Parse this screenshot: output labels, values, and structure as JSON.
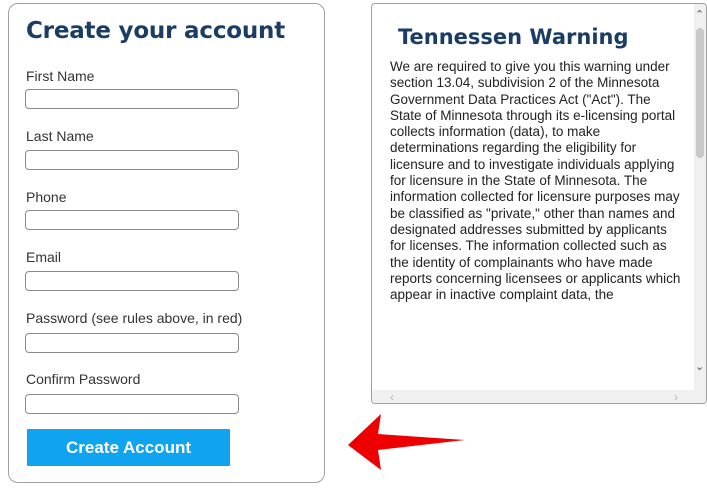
{
  "form": {
    "title": "Create your account",
    "fields": [
      {
        "label": "First Name",
        "value": ""
      },
      {
        "label": "Last Name",
        "value": ""
      },
      {
        "label": "Phone",
        "value": ""
      },
      {
        "label": "Email",
        "value": ""
      },
      {
        "label": "Password (see rules above, in red)",
        "value": ""
      },
      {
        "label": "Confirm Password",
        "value": ""
      }
    ],
    "submit_label": "Create Account",
    "submit_color": "#10a4f0",
    "title_color": "#1b3d64"
  },
  "warning": {
    "title": "Tennessen Warning",
    "body": "We are required to give you this warning under section 13.04, subdivision 2 of the Minnesota Government Data Practices Act (\"Act\"). The State of Minnesota through its e-licensing portal collects information (data), to make determinations regarding the eligibility for licensure and to investigate individuals applying for licensure in the State of Minnesota. The information collected for licensure purposes may be classified as \"private,\" other than names and designated addresses submitted by applicants for licenses. The information collected such as the identity of complainants who have made reports concerning licensees or applicants which appear in inactive complaint data, the"
  },
  "annotation": {
    "arrow_color": "#ee0000",
    "icon": "red-arrow-left-icon"
  }
}
